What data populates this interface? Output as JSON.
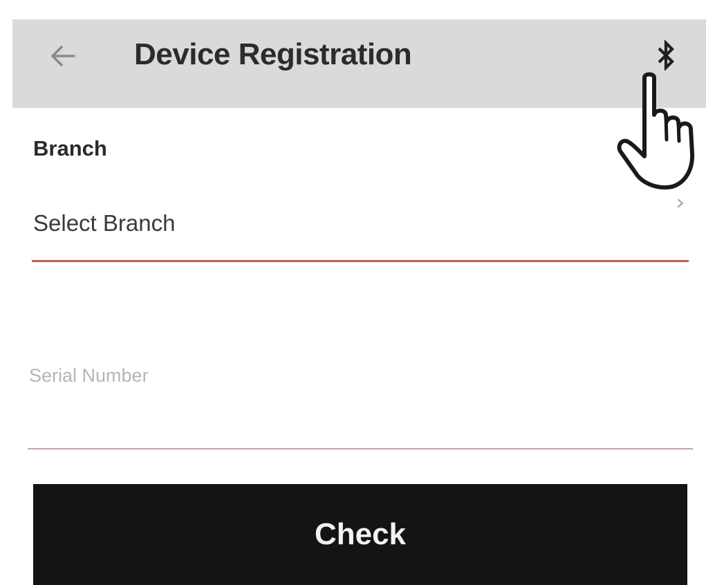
{
  "appbar": {
    "title": "Device Registration",
    "back_icon": "arrow-left-icon",
    "action_icon": "bluetooth-icon",
    "background": "#d9dadc"
  },
  "form": {
    "branch": {
      "label": "Branch",
      "value": "Select Branch",
      "chevron_icon": "chevron-right-icon",
      "underline_color": "#d9534f"
    },
    "serial": {
      "placeholder": "Serial Number",
      "value": ""
    },
    "check_label": "Check"
  },
  "overlay": {
    "pointer_icon": "hand-pointer-icon"
  },
  "colors": {
    "button_bg": "#121416",
    "accent_red": "#d9534f"
  }
}
